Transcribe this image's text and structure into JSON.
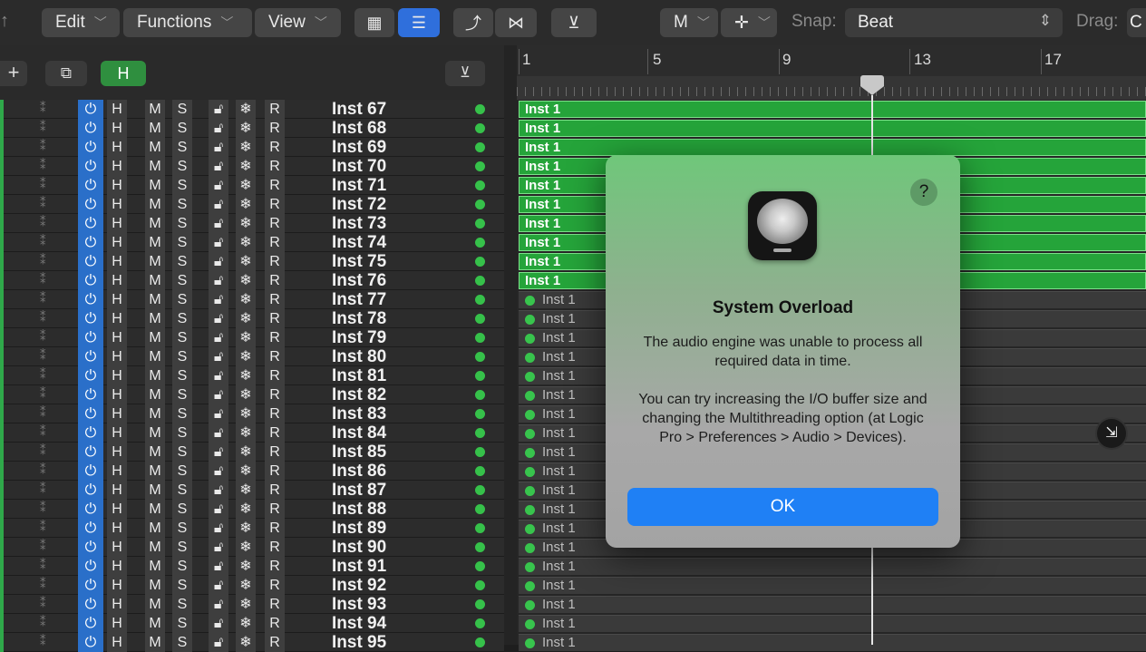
{
  "toolbar": {
    "edit": "Edit",
    "functions": "Functions",
    "view": "View",
    "mode": "M",
    "snap_label": "Snap:",
    "snap_value": "Beat",
    "drag_label": "Drag:",
    "drag_value": "C"
  },
  "header": {
    "h_label": "H"
  },
  "ruler": {
    "bars": [
      "1",
      "5",
      "9",
      "13",
      "17"
    ]
  },
  "track_buttons": {
    "h": "H",
    "m": "M",
    "s": "S",
    "r": "R"
  },
  "tracks": [
    {
      "name": "Inst 67",
      "region": "Inst 1",
      "selected": true
    },
    {
      "name": "Inst 68",
      "region": "Inst 1",
      "selected": true
    },
    {
      "name": "Inst 69",
      "region": "Inst 1",
      "selected": true
    },
    {
      "name": "Inst 70",
      "region": "Inst 1",
      "selected": true
    },
    {
      "name": "Inst 71",
      "region": "Inst 1",
      "selected": true
    },
    {
      "name": "Inst 72",
      "region": "Inst 1",
      "selected": true
    },
    {
      "name": "Inst 73",
      "region": "Inst 1",
      "selected": true
    },
    {
      "name": "Inst 74",
      "region": "Inst 1",
      "selected": true
    },
    {
      "name": "Inst 75",
      "region": "Inst 1",
      "selected": true
    },
    {
      "name": "Inst 76",
      "region": "Inst 1",
      "selected": true
    },
    {
      "name": "Inst 77",
      "region": "Inst 1",
      "selected": false
    },
    {
      "name": "Inst 78",
      "region": "Inst 1",
      "selected": false
    },
    {
      "name": "Inst 79",
      "region": "Inst 1",
      "selected": false
    },
    {
      "name": "Inst 80",
      "region": "Inst 1",
      "selected": false
    },
    {
      "name": "Inst 81",
      "region": "Inst 1",
      "selected": false
    },
    {
      "name": "Inst 82",
      "region": "Inst 1",
      "selected": false
    },
    {
      "name": "Inst 83",
      "region": "Inst 1",
      "selected": false
    },
    {
      "name": "Inst 84",
      "region": "Inst 1",
      "selected": false
    },
    {
      "name": "Inst 85",
      "region": "Inst 1",
      "selected": false
    },
    {
      "name": "Inst 86",
      "region": "Inst 1",
      "selected": false
    },
    {
      "name": "Inst 87",
      "region": "Inst 1",
      "selected": false
    },
    {
      "name": "Inst 88",
      "region": "Inst 1",
      "selected": false
    },
    {
      "name": "Inst 89",
      "region": "Inst 1",
      "selected": false
    },
    {
      "name": "Inst 90",
      "region": "Inst 1",
      "selected": false
    },
    {
      "name": "Inst 91",
      "region": "Inst 1",
      "selected": false
    },
    {
      "name": "Inst 92",
      "region": "Inst 1",
      "selected": false
    },
    {
      "name": "Inst 93",
      "region": "Inst 1",
      "selected": false
    },
    {
      "name": "Inst 94",
      "region": "Inst 1",
      "selected": false
    },
    {
      "name": "Inst 95",
      "region": "Inst 1",
      "selected": false
    }
  ],
  "dialog": {
    "help": "?",
    "title": "System Overload",
    "message": "The audio engine was unable to process all required data in time.\n\nYou can try increasing the I/O buffer size and changing the Multithreading option (at Logic Pro > Preferences > Audio > Devices).",
    "ok_label": "OK"
  },
  "colors": {
    "region_selected": "#25a43a",
    "ok_button": "#1f80f5",
    "power_button": "#2a6fc9"
  }
}
